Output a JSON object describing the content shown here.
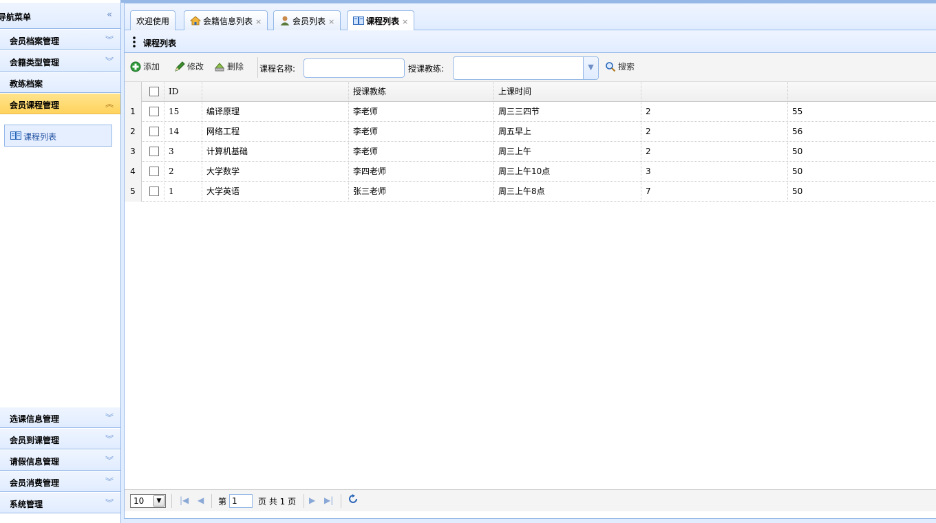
{
  "nav": {
    "title": "导航菜单",
    "collapse_glyph": "«",
    "panels": [
      {
        "label": "会员档案管理",
        "chevron": "︾"
      },
      {
        "label": "会籍类型管理",
        "chevron": "︾"
      },
      {
        "label": "教练档案",
        "chevron": ""
      },
      {
        "label": "会员课程管理",
        "chevron": "︽"
      }
    ],
    "sub_item": {
      "label": "课程列表",
      "icon": "book-icon"
    },
    "bottom_panels": [
      {
        "label": "选课信息管理",
        "chevron": "︾"
      },
      {
        "label": "会员到课管理",
        "chevron": "︾"
      },
      {
        "label": "请假信息管理",
        "chevron": "︾"
      },
      {
        "label": "会员消费管理",
        "chevron": "︾"
      },
      {
        "label": "系统管理",
        "chevron": "︾"
      }
    ]
  },
  "tabs": [
    {
      "label": "欢迎使用",
      "closable": false,
      "icon": ""
    },
    {
      "label": "会籍信息列表",
      "closable": true,
      "icon": "house-icon"
    },
    {
      "label": "会员列表",
      "closable": true,
      "icon": "user-icon"
    },
    {
      "label": "课程列表",
      "closable": true,
      "icon": "book-icon",
      "active": true
    }
  ],
  "tab_close_glyph": "×",
  "panel_title": "课程列表",
  "toolbar": {
    "add_label": "添加",
    "edit_label": "修改",
    "delete_label": "删除",
    "course_name_label": "课程名称:",
    "course_name_value": "",
    "coach_label": "授课教练:",
    "coach_value": "",
    "search_label": "搜索"
  },
  "grid": {
    "headers": {
      "id": "ID",
      "name": "",
      "coach": "授课教练",
      "time": "上课时间",
      "a": "",
      "b": ""
    },
    "rows": [
      {
        "rn": "1",
        "id": "15",
        "name": "编译原理",
        "coach": "李老师",
        "time": "周三三四节",
        "a": "2",
        "b": "55"
      },
      {
        "rn": "2",
        "id": "14",
        "name": "网络工程",
        "coach": "李老师",
        "time": "周五早上",
        "a": "2",
        "b": "56"
      },
      {
        "rn": "3",
        "id": "3",
        "name": "计算机基础",
        "coach": "李老师",
        "time": "周三上午",
        "a": "2",
        "b": "50"
      },
      {
        "rn": "4",
        "id": "2",
        "name": "大学数学",
        "coach": "李四老师",
        "time": "周三上午10点",
        "a": "3",
        "b": "50"
      },
      {
        "rn": "5",
        "id": "1",
        "name": "大学英语",
        "coach": "张三老师",
        "time": "周三上午8点",
        "a": "7",
        "b": "50"
      }
    ]
  },
  "pager": {
    "page_size": "10",
    "page_prefix": "第",
    "current_page": "1",
    "page_suffix": "页 共 1 页"
  },
  "colors": {
    "accent": "#95b8e7",
    "active_panel": "#ffd35d"
  }
}
